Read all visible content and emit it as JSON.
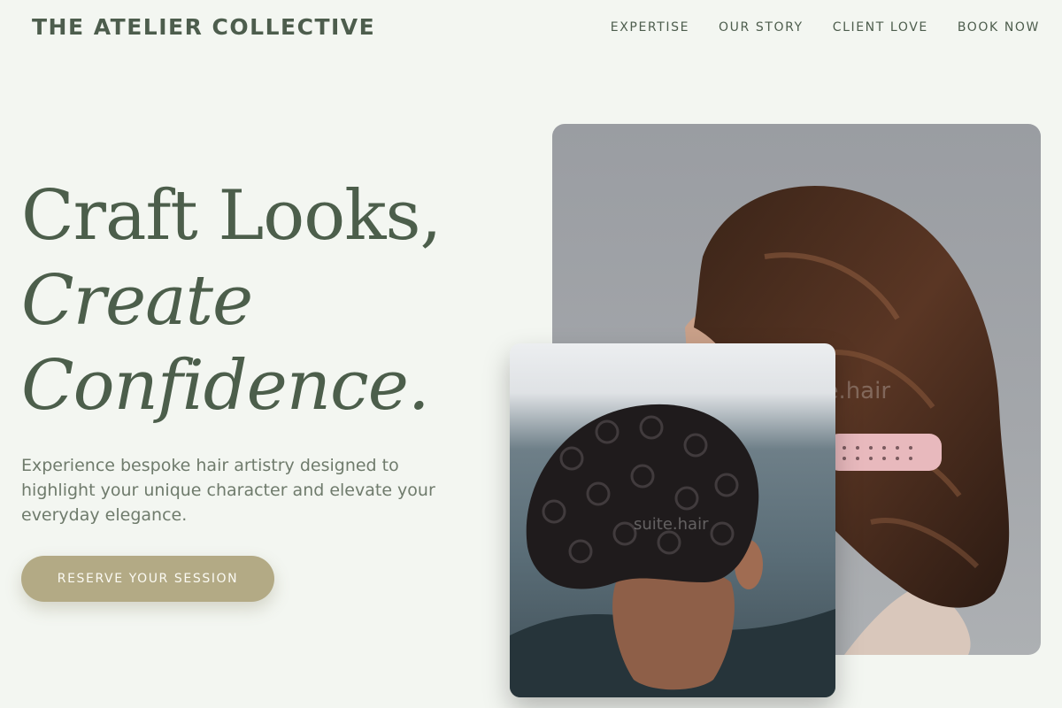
{
  "header": {
    "brand": "THE ATELIER COLLECTIVE",
    "nav": [
      "EXPERTISE",
      "OUR STORY",
      "CLIENT LOVE",
      "BOOK NOW"
    ]
  },
  "hero": {
    "title_line1": "Craft Looks,",
    "title_line2": "Create",
    "title_line3": "Confidence.",
    "subtitle": "Experience bespoke hair artistry designed to highlight your unique character and elevate your everyday elegance.",
    "cta_label": "RESERVE YOUR SESSION"
  },
  "images": {
    "back": {
      "watermark": "suite.hair"
    },
    "front": {
      "watermark": "suite.hair"
    }
  },
  "colors": {
    "background": "#f3f6f1",
    "text_primary": "#4c5e4b",
    "text_secondary": "#6f7b6c",
    "cta": "#b3aa85"
  }
}
